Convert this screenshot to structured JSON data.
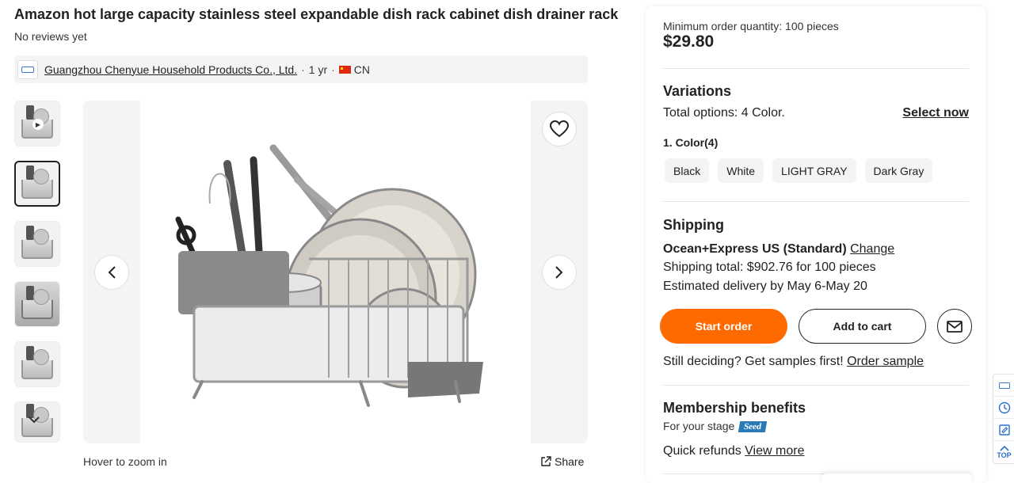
{
  "product": {
    "title": "Amazon hot large capacity stainless steel expandable dish rack cabinet dish drainer rack",
    "reviews": "No reviews yet"
  },
  "supplier": {
    "name": "Guangzhou Chenyue Household Products Co., Ltd.",
    "years": "1 yr",
    "country": "CN",
    "sep": "·"
  },
  "gallery": {
    "thumbnails": [
      "video-thumb",
      "image-2",
      "image-3",
      "image-4",
      "image-5",
      "image-6"
    ],
    "active_index": 1,
    "hover_hint": "Hover to zoom in",
    "share_label": "Share"
  },
  "purchase": {
    "moq": "Minimum order quantity: 100 pieces",
    "price": "$29.80"
  },
  "variations": {
    "heading": "Variations",
    "total_prefix": "Total options: ",
    "total_value": "4 Color.",
    "select_now": "Select now",
    "color_label": "1. Color(4)",
    "colors": [
      "Black",
      "White",
      "LIGHT GRAY",
      "Dark Gray"
    ]
  },
  "shipping": {
    "heading": "Shipping",
    "method": "Ocean+Express US (Standard)",
    "change": "Change",
    "total": "Shipping total: $902.76 for 100 pieces",
    "delivery": "Estimated delivery by May 6-May 20"
  },
  "actions": {
    "start_order": "Start order",
    "add_to_cart": "Add to cart"
  },
  "samples": {
    "prompt": "Still deciding? Get samples first!",
    "link": "Order sample"
  },
  "membership": {
    "heading": "Membership benefits",
    "stage_label": "For your stage",
    "badge": "Seed",
    "refunds": "Quick refunds",
    "view_more": "View more"
  },
  "side_tools": {
    "top_label": "TOP"
  },
  "colors": {
    "accent": "#ff6a00",
    "badge": "#2a7ab8",
    "text": "#222222"
  }
}
